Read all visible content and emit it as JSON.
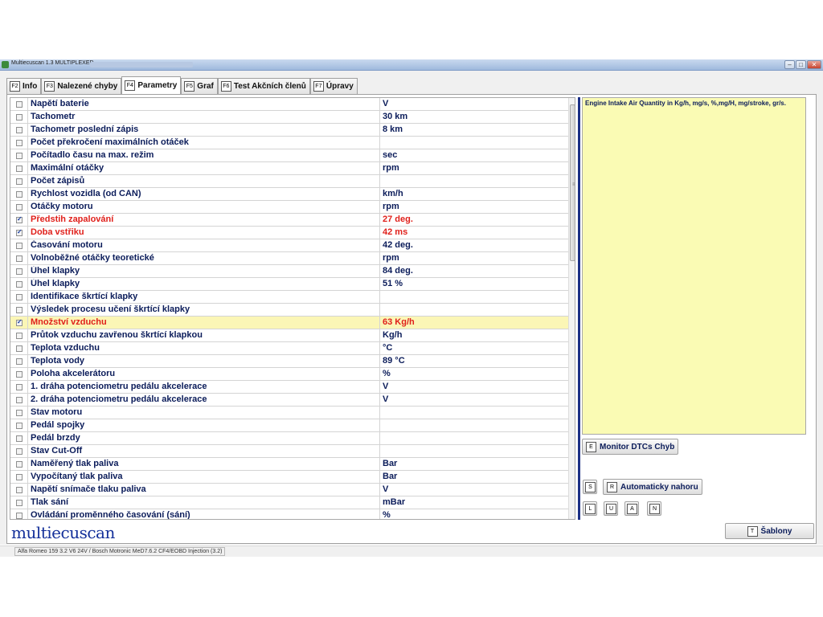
{
  "window": {
    "title": "Multiecuscan 1.3 MULTIPLEXED",
    "minimize": "–",
    "maximize": "□",
    "close": "✕"
  },
  "tabs": [
    {
      "key": "F2",
      "label": "Info"
    },
    {
      "key": "F3",
      "label": "Nalezené chyby"
    },
    {
      "key": "F4",
      "label": "Parametry"
    },
    {
      "key": "F5",
      "label": "Graf"
    },
    {
      "key": "F6",
      "label": "Test Akčních členů"
    },
    {
      "key": "F7",
      "label": "Úpravy"
    }
  ],
  "active_tab": "Parametry",
  "parameters": [
    {
      "name": "Napětí baterie",
      "value": "V",
      "checked": false
    },
    {
      "name": "Tachometr",
      "value": "30 km",
      "checked": false
    },
    {
      "name": "Tachometr poslední zápis",
      "value": "8 km",
      "checked": false
    },
    {
      "name": "Počet překročení maximálních otáček",
      "value": "",
      "checked": false
    },
    {
      "name": "Počítadlo času na max. režim",
      "value": "sec",
      "checked": false
    },
    {
      "name": "Maximální otáčky",
      "value": "rpm",
      "checked": false
    },
    {
      "name": "Počet zápisů",
      "value": "",
      "checked": false
    },
    {
      "name": "Rychlost vozidla (od CAN)",
      "value": "km/h",
      "checked": false
    },
    {
      "name": "Otáčky motoru",
      "value": "rpm",
      "checked": false
    },
    {
      "name": "Předstih zapalování",
      "value": "27 deg.",
      "checked": true
    },
    {
      "name": "Doba vstřiku",
      "value": "42 ms",
      "checked": true
    },
    {
      "name": "Časování motoru",
      "value": "42 deg.",
      "checked": false
    },
    {
      "name": "Volnoběžné otáčky teoretické",
      "value": "rpm",
      "checked": false
    },
    {
      "name": "Úhel klapky",
      "value": "84 deg.",
      "checked": false
    },
    {
      "name": "Úhel klapky",
      "value": "51 %",
      "checked": false
    },
    {
      "name": "Identifikace škrtící klapky",
      "value": "",
      "checked": false
    },
    {
      "name": "Výsledek procesu učení škrtící klapky",
      "value": "",
      "checked": false
    },
    {
      "name": "Množství vzduchu",
      "value": "63 Kg/h",
      "checked": true,
      "selected": true
    },
    {
      "name": "Průtok vzduchu zavřenou škrtící klapkou",
      "value": "Kg/h",
      "checked": false
    },
    {
      "name": "Teplota vzduchu",
      "value": "°C",
      "checked": false
    },
    {
      "name": "Teplota vody",
      "value": "89 °C",
      "checked": false
    },
    {
      "name": "Poloha akcelerátoru",
      "value": "%",
      "checked": false
    },
    {
      "name": "1. dráha potenciometru pedálu akcelerace",
      "value": "V",
      "checked": false
    },
    {
      "name": "2. dráha potenciometru pedálu akcelerace",
      "value": "V",
      "checked": false
    },
    {
      "name": "Stav motoru",
      "value": "",
      "checked": false
    },
    {
      "name": "Pedál spojky",
      "value": "",
      "checked": false
    },
    {
      "name": "Pedál brzdy",
      "value": "",
      "checked": false
    },
    {
      "name": "Stav Cut-Off",
      "value": "",
      "checked": false
    },
    {
      "name": "Naměřený tlak paliva",
      "value": "Bar",
      "checked": false
    },
    {
      "name": "Vypočítaný tlak paliva",
      "value": "Bar",
      "checked": false
    },
    {
      "name": "Napětí snímače tlaku paliva",
      "value": "V",
      "checked": false
    },
    {
      "name": "Tlak sání",
      "value": "mBar",
      "checked": false
    },
    {
      "name": "Ovládání proměnného časování (sání)",
      "value": "%",
      "checked": false
    }
  ],
  "description": "Engine Intake Air Quantity in Kg/h, mg/s, %,mg/H, mg/stroke, gr/s.",
  "buttons": {
    "monitor": {
      "key": "E",
      "label": "Monitor DTCs Chyb"
    },
    "s": {
      "key": "S"
    },
    "auto_top": {
      "key": "R",
      "label": "Automaticky nahoru"
    },
    "l": {
      "key": "L"
    },
    "u": {
      "key": "U"
    },
    "a": {
      "key": "A"
    },
    "n": {
      "key": "N"
    },
    "templates": {
      "key": "T",
      "label": "Šablony"
    }
  },
  "logo": "multiecuscan",
  "status": "Alfa Romeo 159 3.2 V6 24V / Bosch Motronic MeD7.6.2 CF4/EOBD Injection (3.2)",
  "colors": {
    "selected_row": "#fbf6b6",
    "red_text": "#e0201b",
    "label_text": "#0b1c5a",
    "description_bg": "#fafbb4",
    "divider": "#1b2f86"
  }
}
